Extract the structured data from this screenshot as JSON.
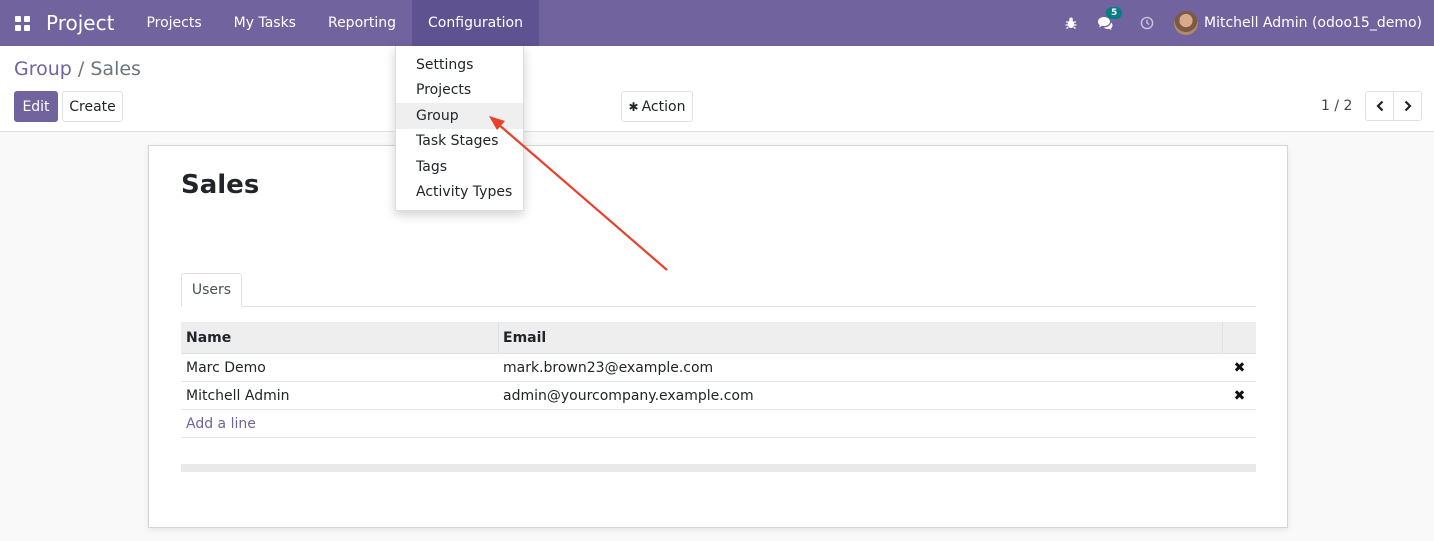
{
  "navbar": {
    "app_name": "Project",
    "menu": [
      "Projects",
      "My Tasks",
      "Reporting",
      "Configuration"
    ],
    "active_menu": "Configuration",
    "message_count": "5",
    "user_name": "Mitchell Admin (odoo15_demo)",
    "brand_color": "#71639e"
  },
  "breadcrumb": {
    "parent": "Group",
    "separator": "/",
    "current": "Sales"
  },
  "buttons": {
    "edit": "Edit",
    "create": "Create",
    "action": "Action"
  },
  "pager": {
    "value": "1 / 2"
  },
  "configuration_menu": {
    "items": [
      "Settings",
      "Projects",
      "Group",
      "Task Stages",
      "Tags",
      "Activity Types"
    ],
    "highlighted": "Group"
  },
  "form": {
    "title": "Sales",
    "tabs": [
      "Users"
    ],
    "columns": [
      "Name",
      "Email"
    ],
    "rows": [
      {
        "name": "Marc Demo",
        "email": "mark.brown23@example.com"
      },
      {
        "name": "Mitchell Admin",
        "email": "admin@yourcompany.example.com"
      }
    ],
    "add_line": "Add a line"
  },
  "icons": {
    "apps": "apps-grid-icon",
    "debug": "bug-icon",
    "messages": "chat-bubbles-icon",
    "activity": "clock-icon",
    "action": "gear-icon",
    "delete": "close-x-icon",
    "pager_prev": "chevron-left-icon",
    "pager_next": "chevron-right-icon"
  }
}
